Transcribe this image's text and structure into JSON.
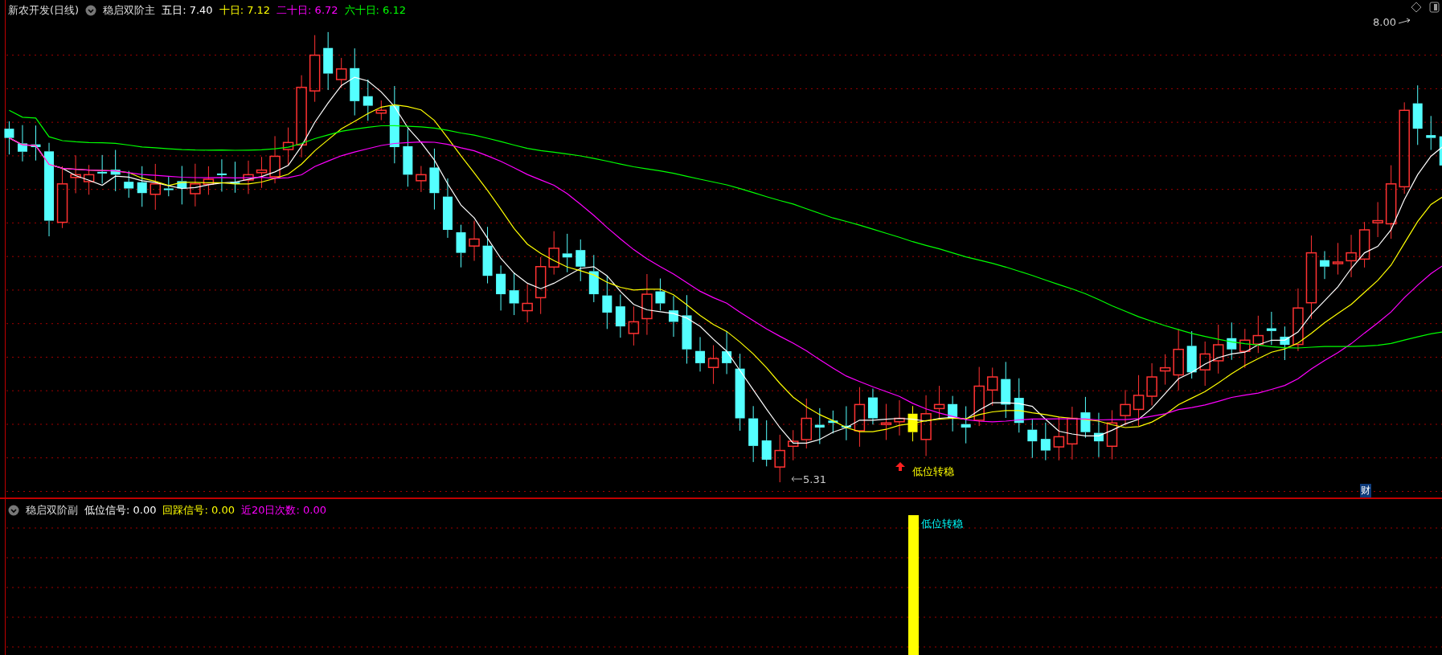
{
  "main_panel": {
    "title": "新农开发(日线)",
    "indicator": "稳启双阶主",
    "ma_values": [
      {
        "label": "五日:",
        "value": "7.40",
        "color": "#ffffff"
      },
      {
        "label": "十日:",
        "value": "7.12",
        "color": "#ffff00"
      },
      {
        "label": "二十日:",
        "value": "6.72",
        "color": "#ff00ff"
      },
      {
        "label": "六十日:",
        "value": "6.12",
        "color": "#00ff00"
      }
    ],
    "high_label": "8.00",
    "low_label": "5.31",
    "signal_label": "低位转稳",
    "badge": "财"
  },
  "sub_panel": {
    "indicator": "稳启双阶副",
    "values": [
      {
        "label": "低位信号:",
        "value": "0.00",
        "color": "#ffffff"
      },
      {
        "label": "回踩信号:",
        "value": "0.00",
        "color": "#ffff00"
      },
      {
        "label": "近20日次数:",
        "value": "0.00",
        "color": "#ff00ff"
      }
    ],
    "signal_label": "低位转稳"
  }
}
